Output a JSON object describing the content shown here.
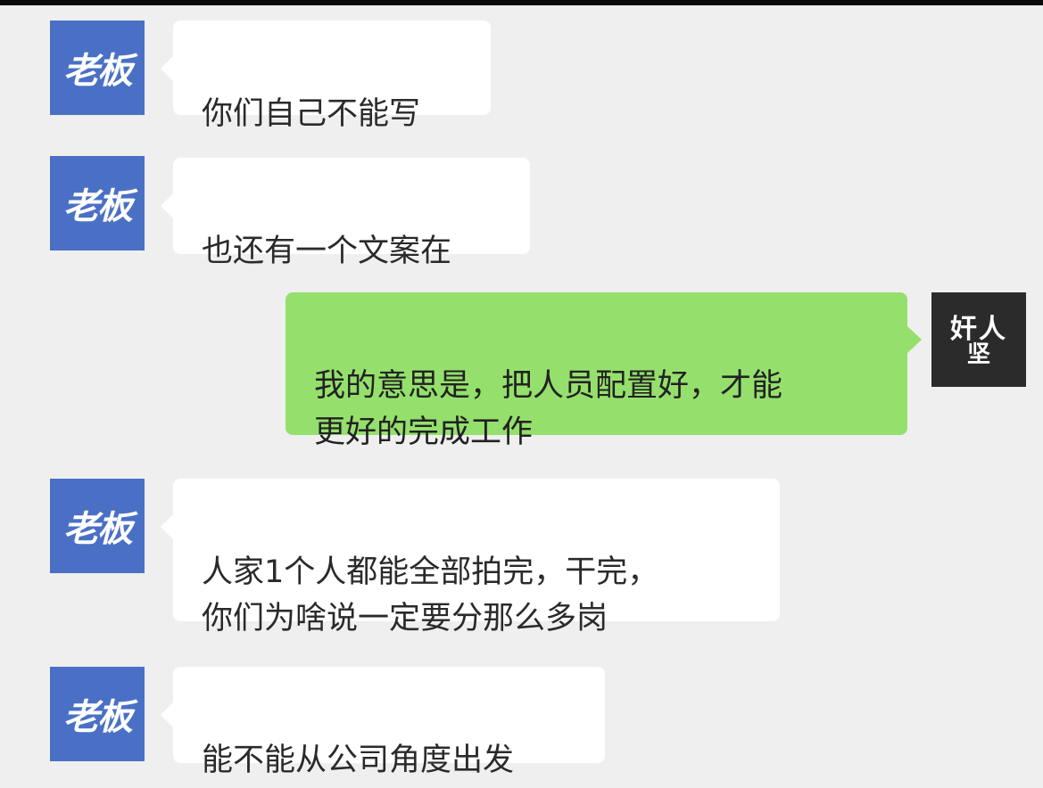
{
  "chat": {
    "boss_name": "老板",
    "self_name_line1": "奸人",
    "self_name_line2": "坚",
    "messages": [
      {
        "sender": "boss",
        "text": "你们自己不能写"
      },
      {
        "sender": "boss",
        "text": "也还有一个文案在"
      },
      {
        "sender": "self",
        "text": "我的意思是，把人员配置好，才能\n更好的完成工作"
      },
      {
        "sender": "boss",
        "text": "人家1个人都能全部拍完，干完，\n你们为啥说一定要分那么多岗"
      },
      {
        "sender": "boss",
        "text": "能不能从公司角度出发"
      }
    ]
  },
  "colors": {
    "background": "#efefef",
    "boss_avatar": "#4a70c6",
    "self_avatar": "#2b2b2b",
    "incoming_bubble": "#ffffff",
    "outgoing_bubble": "#95e06c"
  }
}
